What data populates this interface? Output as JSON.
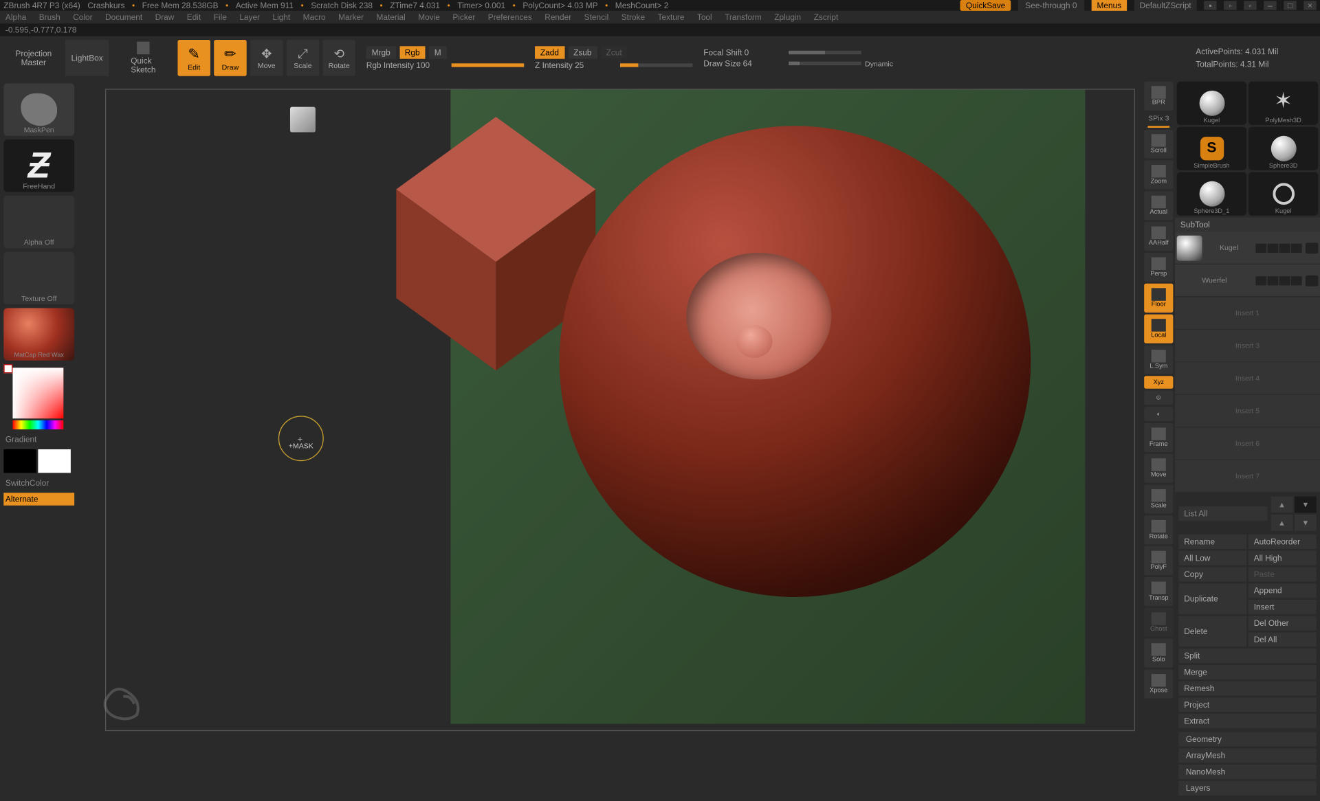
{
  "title": {
    "app": "ZBrush 4R7 P3 (x64)",
    "project": "Crashkurs",
    "freemem": "Free Mem 28.538GB",
    "activemem": "Active Mem 911",
    "scratch": "Scratch Disk 238",
    "ztime": "ZTime7 4.031",
    "timer": "Timer> 0.001",
    "polycount": "PolyCount> 4.03 MP",
    "meshcount": "MeshCount> 2",
    "quicksave": "QuickSave",
    "seethrough": "See-through   0",
    "menus": "Menus",
    "script": "DefaultZScript"
  },
  "menus": [
    "Alpha",
    "Brush",
    "Color",
    "Document",
    "Draw",
    "Edit",
    "File",
    "Layer",
    "Light",
    "Macro",
    "Marker",
    "Material",
    "Movie",
    "Picker",
    "Preferences",
    "Render",
    "Stencil",
    "Stroke",
    "Texture",
    "Tool",
    "Transform",
    "Zplugin",
    "Zscript"
  ],
  "status": "-0.595,-0.777,0.178",
  "toolbar": {
    "projection": "Projection\nMaster",
    "lightbox": "LightBox",
    "quicksketch": "Quick\nSketch",
    "edit": "Edit",
    "draw": "Draw",
    "move": "Move",
    "scale": "Scale",
    "rotate": "Rotate",
    "mrgb": "Mrgb",
    "rgb": "Rgb",
    "m": "M",
    "rgbint": "Rgb Intensity 100",
    "zadd": "Zadd",
    "zsub": "Zsub",
    "zcut": "Zcut",
    "zint": "Z Intensity 25",
    "focal": "Focal Shift 0",
    "drawsize": "Draw Size 64",
    "dynamic": "Dynamic",
    "active": "ActivePoints: 4.031 Mil",
    "total": "TotalPoints: 4.31 Mil"
  },
  "left": {
    "brush": "MaskPen",
    "stroke": "FreeHand",
    "alpha": "Alpha Off",
    "texture": "Texture Off",
    "material": "MatCap Red Wax",
    "gradient": "Gradient",
    "switchcolor": "SwitchColor",
    "alternate": "Alternate"
  },
  "cursor": "+MASK",
  "rightshelf": {
    "spix": "SPix 3",
    "items": [
      "BPR",
      "Scroll",
      "Zoom",
      "Actual",
      "AAHalf",
      "Persp",
      "Floor",
      "Local",
      "L.Sym",
      "Xyz",
      "",
      "",
      "Frame",
      "Move",
      "Scale",
      "Rotate",
      "PolyF",
      "Transp",
      "Ghost",
      "Solo",
      "Xpose"
    ]
  },
  "tools": {
    "grid": [
      {
        "label": "Kugel",
        "type": "ball"
      },
      {
        "label": "PolyMesh3D",
        "type": "star"
      },
      {
        "label": "SimpleBrush",
        "type": "sbrush"
      },
      {
        "label": "Sphere3D",
        "type": "ball"
      },
      {
        "label": "Sphere3D_1",
        "type": "ball"
      },
      {
        "label": "Kugel",
        "type": "ring"
      }
    ]
  },
  "subtool": {
    "header": "SubTool",
    "items": [
      {
        "name": "Kugel",
        "type": "ball",
        "dim": false
      },
      {
        "name": "Wuerfel",
        "type": "cube",
        "dim": true
      },
      {
        "name": "Insert 1",
        "type": "",
        "dim": true
      },
      {
        "name": "Insert 3",
        "type": "",
        "dim": true
      },
      {
        "name": "Insert 4",
        "type": "",
        "dim": true
      },
      {
        "name": "Insert 5",
        "type": "",
        "dim": true
      },
      {
        "name": "Insert 6",
        "type": "",
        "dim": true
      },
      {
        "name": "Insert 7",
        "type": "",
        "dim": true
      }
    ],
    "listall": "List All"
  },
  "buttons": {
    "rename": "Rename",
    "autoreorder": "AutoReorder",
    "alllow": "All Low",
    "allhigh": "All High",
    "copy": "Copy",
    "paste": "Paste",
    "duplicate": "Duplicate",
    "append": "Append",
    "insert": "Insert",
    "delete": "Delete",
    "delother": "Del Other",
    "delall": "Del All",
    "split": "Split",
    "merge": "Merge",
    "remesh": "Remesh",
    "project": "Project",
    "extract": "Extract"
  },
  "accordion": [
    "Geometry",
    "ArrayMesh",
    "NanoMesh",
    "Layers"
  ]
}
